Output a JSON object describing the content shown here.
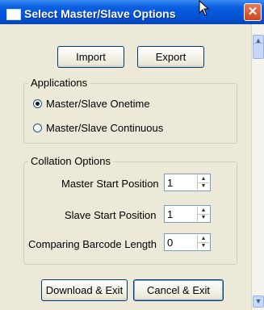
{
  "window": {
    "title": "Select Master/Slave Options",
    "close_glyph": "✕"
  },
  "toolbar": {
    "import_label": "Import",
    "export_label": "Export"
  },
  "applications": {
    "legend": "Applications",
    "options": [
      {
        "label": "Master/Slave Onetime",
        "checked": true
      },
      {
        "label": "Master/Slave Continuous",
        "checked": false
      }
    ]
  },
  "collation": {
    "legend": "Collation Options",
    "fields": [
      {
        "label": "Master Start Position",
        "value": "1"
      },
      {
        "label": "Slave Start Position",
        "value": "1"
      },
      {
        "label": "Comparing Barcode Length",
        "value": "0"
      }
    ]
  },
  "footer": {
    "download_label": "Download & Exit",
    "cancel_label": "Cancel & Exit"
  },
  "icons": {
    "spin_up": "▲",
    "spin_down": "▼",
    "scroll_up": "▲",
    "scroll_down": "▼"
  }
}
